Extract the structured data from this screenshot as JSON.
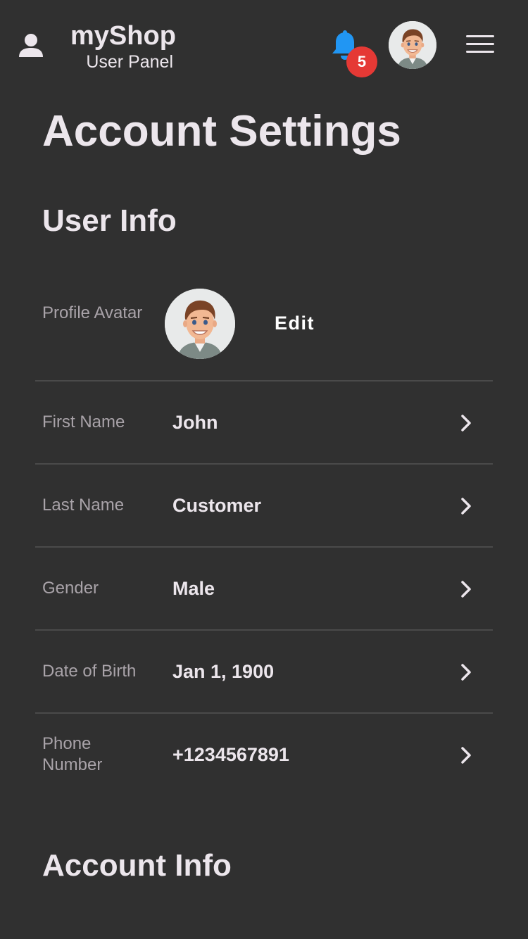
{
  "header": {
    "brand_name": "myShop",
    "brand_subtitle": "User Panel",
    "notification_count": "5",
    "icons": [
      "user-icon",
      "bell-icon",
      "menu-icon"
    ],
    "colors": {
      "bell": "#2196f3",
      "badge": "#e53935",
      "background": "#303030"
    }
  },
  "page": {
    "title": "Account Settings"
  },
  "user_info": {
    "title": "User Info",
    "avatar_label": "Profile Avatar",
    "edit_label": "Edit",
    "fields": [
      {
        "label": "First Name",
        "value": "John"
      },
      {
        "label": "Last Name",
        "value": "Customer"
      },
      {
        "label": "Gender",
        "value": "Male"
      },
      {
        "label": "Date of Birth",
        "value": "Jan 1, 1900"
      },
      {
        "label": "Phone Number",
        "value": "+1234567891"
      }
    ]
  },
  "account_info": {
    "title": "Account Info"
  }
}
